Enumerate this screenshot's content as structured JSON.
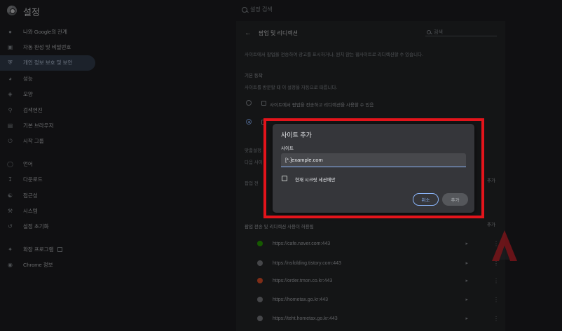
{
  "app": {
    "title": "설정"
  },
  "top_search": {
    "placeholder": "설정 검색"
  },
  "sidebar": {
    "items": [
      {
        "label": "나와 Google의 관계",
        "icon": "person-icon"
      },
      {
        "label": "자동 완성 및 비밀번호",
        "icon": "clipboard-icon"
      },
      {
        "label": "개인 정보 보호 및 보안",
        "icon": "shield-icon",
        "active": true
      },
      {
        "label": "성능",
        "icon": "speedometer-icon"
      },
      {
        "label": "모양",
        "icon": "palette-icon"
      },
      {
        "label": "검색엔진",
        "icon": "search-icon"
      },
      {
        "label": "기본 브라우저",
        "icon": "browser-icon"
      },
      {
        "label": "시작 그룹",
        "icon": "power-icon"
      }
    ],
    "items2": [
      {
        "label": "언어",
        "icon": "globe-icon"
      },
      {
        "label": "다운로드",
        "icon": "download-icon"
      },
      {
        "label": "접근성",
        "icon": "accessibility-icon"
      },
      {
        "label": "시스템",
        "icon": "wrench-icon"
      },
      {
        "label": "설정 초기화",
        "icon": "reset-icon"
      }
    ],
    "items3": [
      {
        "label": "확장 프로그램",
        "icon": "puzzle-icon"
      },
      {
        "label": "Chrome 정보",
        "icon": "chrome-icon"
      }
    ]
  },
  "main": {
    "title": "팝업 및 리디렉션",
    "search_placeholder": "검색",
    "description": "사이트에서 팝업을 전송하여 광고를 표시하거나, 원치 않는 웹사이트로 리디렉션할 수 있습니다.",
    "default_behavior_label": "기본 동작",
    "default_behavior_sub": "사이트를 방문할 때 이 설정을 자동으로 따릅니다.",
    "option_allow": "사이트에서 팝업을 전송하고 리디렉션을 사용할 수 있음",
    "custom_label": "맞춤설정",
    "custom_sub": "다음 사이",
    "block_list_partial": "팝업 전",
    "add_label": "추가",
    "allow_list_title": "팝업 전송 및 리디렉션 사용이 허용됨",
    "allowed_sites": [
      {
        "url": "https://cafe.naver.com:443",
        "icon_color": "#2db400"
      },
      {
        "url": "https://nsfolding.tistory.com:443",
        "icon_color": "#8a8d92"
      },
      {
        "url": "https://order.tmon.co.kr:443",
        "icon_color": "#ff5a2e"
      },
      {
        "url": "https://hometax.go.kr:443",
        "icon_color": "#8a8d92"
      },
      {
        "url": "https://teht.hometax.go.kr:443",
        "icon_color": "#8a8d92"
      }
    ]
  },
  "dialog": {
    "title": "사이트 추가",
    "field_label": "사이트",
    "field_value": "[*.]example.com",
    "checkbox_label": "현재 시크릿 세션에만",
    "cancel_label": "취소",
    "add_label": "추가"
  },
  "colors": {
    "highlight": "#e3141b",
    "accent": "#8ab4f8",
    "active_nav_bg": "#394457"
  }
}
